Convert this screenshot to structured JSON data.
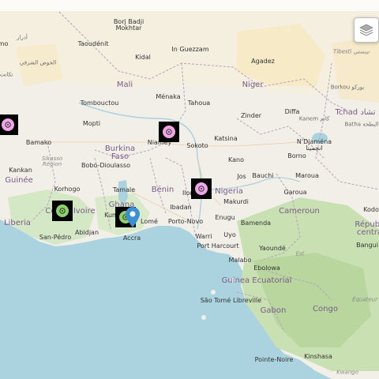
{
  "map": {
    "labels": [
      {
        "id": "borj-badji-mokhtar",
        "text": "Borj Badji\nMokhtar",
        "kind": "city"
      },
      {
        "id": "taoudenit",
        "text": "Taoudénit",
        "kind": "city"
      },
      {
        "id": "in-guezzam",
        "text": "In Guezzam",
        "kind": "city"
      },
      {
        "id": "agadez",
        "text": "Agadez",
        "kind": "city"
      },
      {
        "id": "tibesti",
        "text": "Tibesti تيبستي",
        "kind": "land"
      },
      {
        "id": "kidal",
        "text": "Kidal",
        "kind": "city"
      },
      {
        "id": "mali",
        "text": "Mali",
        "kind": "country"
      },
      {
        "id": "niger",
        "text": "Niger",
        "kind": "country"
      },
      {
        "id": "borkou",
        "text": "Borkou بوركو",
        "kind": "native"
      },
      {
        "id": "tombouctou",
        "text": "Tombouctou",
        "kind": "city"
      },
      {
        "id": "menaka",
        "text": "Ménaka",
        "kind": "city"
      },
      {
        "id": "tahoua",
        "text": "Tahoua",
        "kind": "city"
      },
      {
        "id": "zinder",
        "text": "Zinder",
        "kind": "city"
      },
      {
        "id": "diffa",
        "text": "Diffa",
        "kind": "city"
      },
      {
        "id": "kanem",
        "text": "Kanem كانم",
        "kind": "native"
      },
      {
        "id": "tchad",
        "text": "Tchad تشاد",
        "kind": "country"
      },
      {
        "id": "batha",
        "text": "Batha البطحة",
        "kind": "native"
      },
      {
        "id": "mopti",
        "text": "Mopti",
        "kind": "city"
      },
      {
        "id": "niamey",
        "text": "Niamey",
        "kind": "city"
      },
      {
        "id": "sokoto",
        "text": "Sokoto",
        "kind": "city"
      },
      {
        "id": "katsina",
        "text": "Katsina",
        "kind": "city"
      },
      {
        "id": "ndjamena",
        "text": "N'Djaména\nانجمينا",
        "kind": "city"
      },
      {
        "id": "bamako",
        "text": "Bamako",
        "kind": "city"
      },
      {
        "id": "burkina-faso",
        "text": "Burkina\nFaso",
        "kind": "country"
      },
      {
        "id": "kano",
        "text": "Kano",
        "kind": "city"
      },
      {
        "id": "borno",
        "text": "Borno",
        "kind": "city"
      },
      {
        "id": "sikasso",
        "text": "Sikasso\nRégion",
        "kind": "region"
      },
      {
        "id": "bobo",
        "text": "Bobo-Dioulasso",
        "kind": "city"
      },
      {
        "id": "bauchi",
        "text": "Bauchi",
        "kind": "city"
      },
      {
        "id": "maroua",
        "text": "Maroua",
        "kind": "city"
      },
      {
        "id": "jos",
        "text": "Jos",
        "kind": "city"
      },
      {
        "id": "kankan",
        "text": "Kankan",
        "kind": "city"
      },
      {
        "id": "guinee",
        "text": "Guinée",
        "kind": "country"
      },
      {
        "id": "korhogo",
        "text": "Korhogo",
        "kind": "city"
      },
      {
        "id": "tamale",
        "text": "Tamale",
        "kind": "city"
      },
      {
        "id": "benin",
        "text": "Bénin",
        "kind": "country"
      },
      {
        "id": "ilorin",
        "text": "Ilorin",
        "kind": "city"
      },
      {
        "id": "nigeria",
        "text": "Nigeria",
        "kind": "country"
      },
      {
        "id": "garoua",
        "text": "Garoua",
        "kind": "city"
      },
      {
        "id": "makurdi",
        "text": "Makurdi",
        "kind": "city"
      },
      {
        "id": "ghana",
        "text": "Ghana",
        "kind": "country"
      },
      {
        "id": "ibadan",
        "text": "Ibadan",
        "kind": "city"
      },
      {
        "id": "cameroun",
        "text": "Cameroun",
        "kind": "country"
      },
      {
        "id": "kodo",
        "text": "Kodo",
        "kind": "city"
      },
      {
        "id": "cote-divoire",
        "text": "Côte d'Ivoire",
        "kind": "country"
      },
      {
        "id": "kumasi",
        "text": "Kum",
        "kind": "city"
      },
      {
        "id": "lome",
        "text": "Lomé",
        "kind": "city"
      },
      {
        "id": "porto-novo",
        "text": "Porto-Novo",
        "kind": "city"
      },
      {
        "id": "enugu",
        "text": "Enugu",
        "kind": "city"
      },
      {
        "id": "bamenda",
        "text": "Bamenda",
        "kind": "city"
      },
      {
        "id": "liberia",
        "text": "Liberia",
        "kind": "country"
      },
      {
        "id": "abidjan",
        "text": "Abidjan",
        "kind": "city"
      },
      {
        "id": "accra",
        "text": "Accra",
        "kind": "city"
      },
      {
        "id": "warri",
        "text": "Warri",
        "kind": "city"
      },
      {
        "id": "uyo",
        "text": "Uyo",
        "kind": "city"
      },
      {
        "id": "republique",
        "text": "Républi\ncentra",
        "kind": "country"
      },
      {
        "id": "bangui",
        "text": "Bangui",
        "kind": "city"
      },
      {
        "id": "san-pedro",
        "text": "San-Pédro",
        "kind": "city"
      },
      {
        "id": "port-harcourt",
        "text": "Port Harcourt",
        "kind": "city"
      },
      {
        "id": "yaounde",
        "text": "Yaoundé",
        "kind": "city"
      },
      {
        "id": "est",
        "text": "Est",
        "kind": "region"
      },
      {
        "id": "malabo",
        "text": "Malabo",
        "kind": "city"
      },
      {
        "id": "ebolowa",
        "text": "Ebolowa",
        "kind": "city"
      },
      {
        "id": "guinea-ecuatorial",
        "text": "Guinea Ecuatorial",
        "kind": "country"
      },
      {
        "id": "equateur",
        "text": "Équateur",
        "kind": "region"
      },
      {
        "id": "sao-tome",
        "text": "São Tomé",
        "kind": "city"
      },
      {
        "id": "libreville",
        "text": "Libreville",
        "kind": "city"
      },
      {
        "id": "gabon",
        "text": "Gabon",
        "kind": "country"
      },
      {
        "id": "congo",
        "text": "Congo",
        "kind": "country"
      },
      {
        "id": "pointe-noire",
        "text": "Pointe-Noire",
        "kind": "city"
      },
      {
        "id": "kinshasa",
        "text": "Kinshasa",
        "kind": "city"
      },
      {
        "id": "kwango",
        "text": "Kwango",
        "kind": "region"
      },
      {
        "id": "mo",
        "text": "mo",
        "kind": "city"
      },
      {
        "id": "adrar",
        "text": "أدرار",
        "kind": "native"
      },
      {
        "id": "hodh",
        "text": "الحوض الشرقي",
        "kind": "native"
      },
      {
        "id": "tagant",
        "text": "تكانت",
        "kind": "native"
      }
    ],
    "markers": [
      {
        "id": "m1",
        "color": "#f0a6e6"
      },
      {
        "id": "m2",
        "color": "#f0a6e6"
      },
      {
        "id": "m3",
        "color": "#f0a6e6"
      },
      {
        "id": "m4",
        "color": "#8cd16a"
      },
      {
        "id": "m5",
        "color": "#8cd16a"
      }
    ],
    "pin": {
      "label": "Accra",
      "color": "#3b8fd4"
    },
    "layers_button": {
      "icon": "layers-icon"
    }
  }
}
